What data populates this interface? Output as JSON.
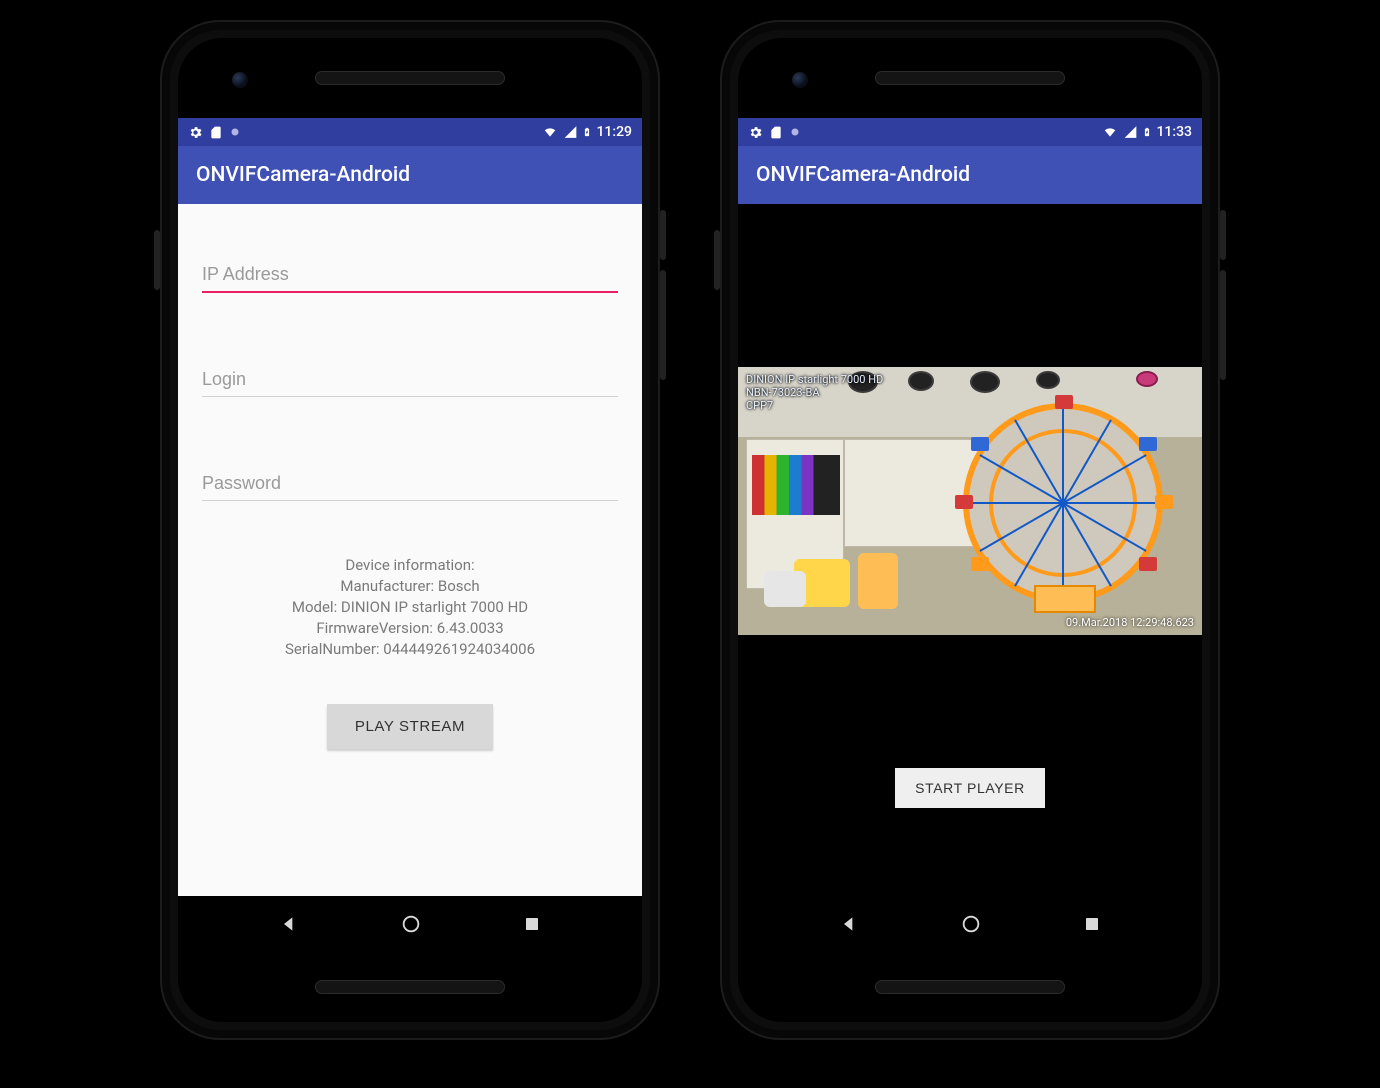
{
  "phones": {
    "left": {
      "status": {
        "time": "11:29"
      },
      "app_title": "ONVIFCamera-Android",
      "fields": {
        "ip_placeholder": "IP Address",
        "login_placeholder": "Login",
        "password_placeholder": "Password"
      },
      "device_info": {
        "heading": "Device information:",
        "manufacturer_line": "Manufacturer: Bosch",
        "model_line": "Model: DINION IP starlight 7000 HD",
        "firmware_line": "FirmwareVersion: 6.43.0033",
        "serial_line": "SerialNumber: 044449261924034006"
      },
      "play_button": "PLAY STREAM"
    },
    "right": {
      "status": {
        "time": "11:33"
      },
      "app_title": "ONVIFCamera-Android",
      "stream_overlay": {
        "line1": "DINION IP starlight 7000 HD",
        "line2": "NBN-73023-BA",
        "line3": "CPP7",
        "timestamp": "09.Mar.2018   12:29:48.623"
      },
      "start_button": "START PLAYER"
    }
  }
}
